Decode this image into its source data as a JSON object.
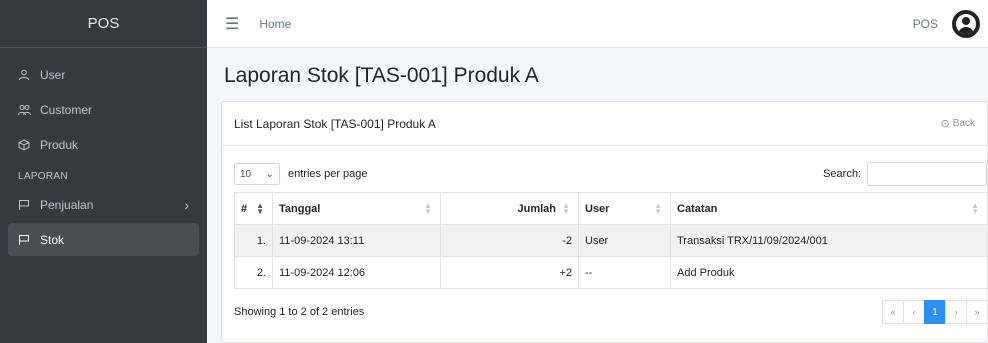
{
  "app": {
    "brand": "POS"
  },
  "topbar": {
    "home_label": "Home",
    "right_label": "POS"
  },
  "sidebar": {
    "items": [
      {
        "label": "User",
        "icon": "user-icon"
      },
      {
        "label": "Customer",
        "icon": "users-icon"
      },
      {
        "label": "Produk",
        "icon": "cube-icon"
      }
    ],
    "section_header": "LAPORAN",
    "report_items": [
      {
        "label": "Penjualan",
        "icon": "flag-icon",
        "has_children": true
      },
      {
        "label": "Stok",
        "icon": "flag-icon",
        "active": true
      }
    ]
  },
  "page": {
    "title": "Laporan Stok [TAS-001] Produk A"
  },
  "card": {
    "title": "List Laporan Stok [TAS-001] Produk A",
    "back_label": "Back"
  },
  "table_controls": {
    "entries_value": "10",
    "entries_label": "entries per page",
    "search_label": "Search:",
    "search_value": ""
  },
  "table": {
    "headers": [
      "#",
      "Tanggal",
      "Jumlah",
      "User",
      "Catatan"
    ],
    "rows": [
      [
        "1.",
        "11-09-2024 13:11",
        "-2",
        "User",
        "Transaksi TRX/11/09/2024/001"
      ],
      [
        "2.",
        "11-09-2024 12:06",
        "+2",
        "--",
        "Add Produk"
      ]
    ]
  },
  "footer": {
    "info": "Showing 1 to 2 of 2 entries",
    "pagination": {
      "first": "«",
      "prev": "‹",
      "current": "1",
      "next": "›",
      "last": "»"
    }
  },
  "colors": {
    "sidebar_bg": "#343a40",
    "active_item_bg": "#494e53",
    "accent": "#2f8fee"
  }
}
